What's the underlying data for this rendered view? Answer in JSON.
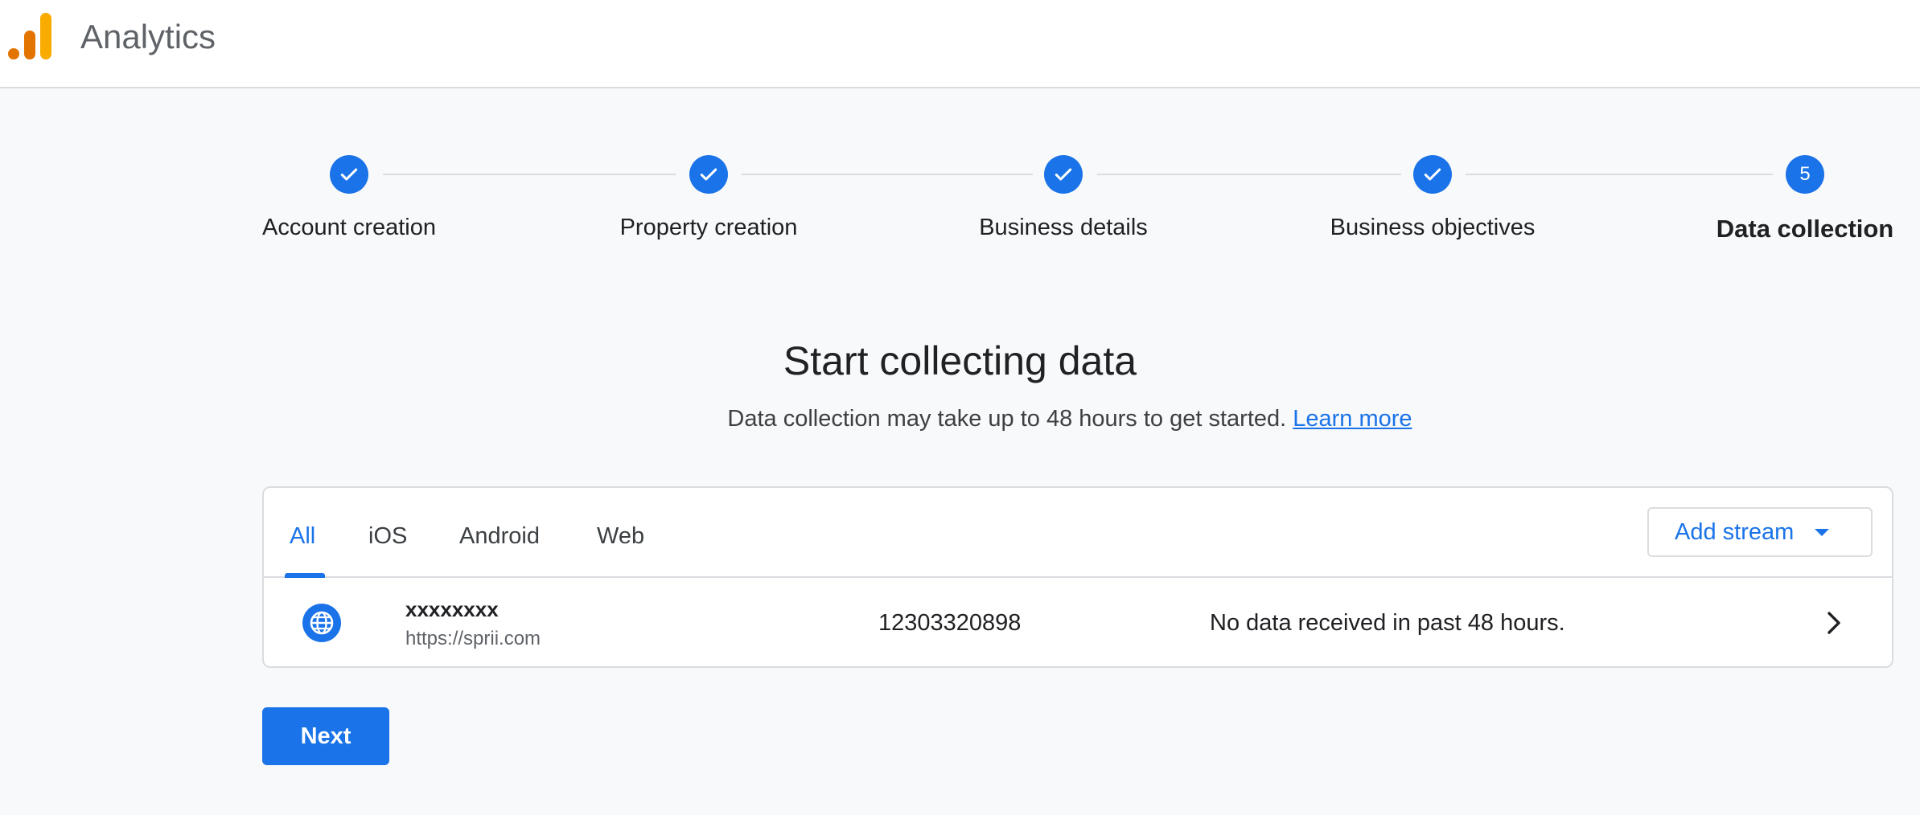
{
  "header": {
    "app_title": "Analytics"
  },
  "stepper": {
    "steps": [
      {
        "label": "Account creation",
        "state": "done"
      },
      {
        "label": "Property creation",
        "state": "done"
      },
      {
        "label": "Business details",
        "state": "done"
      },
      {
        "label": "Business objectives",
        "state": "done"
      },
      {
        "label": "Data collection",
        "state": "current",
        "number": "5"
      }
    ]
  },
  "main": {
    "heading": "Start collecting data",
    "subtitle": "Data collection may take up to 48 hours to get started.",
    "learn_more": "Learn more"
  },
  "streams": {
    "tabs": [
      {
        "label": "All",
        "active": true
      },
      {
        "label": "iOS",
        "active": false
      },
      {
        "label": "Android",
        "active": false
      },
      {
        "label": "Web",
        "active": false
      }
    ],
    "add_stream_label": "Add stream",
    "rows": [
      {
        "icon": "globe-icon",
        "name": "xxxxxxxx",
        "url": "https://sprii.com",
        "id": "12303320898",
        "status": "No data received in past 48 hours."
      }
    ]
  },
  "footer": {
    "next_label": "Next"
  },
  "colors": {
    "accent": "#1a73e8",
    "logo_orange": "#e37400",
    "logo_yellow": "#f9ab00"
  }
}
